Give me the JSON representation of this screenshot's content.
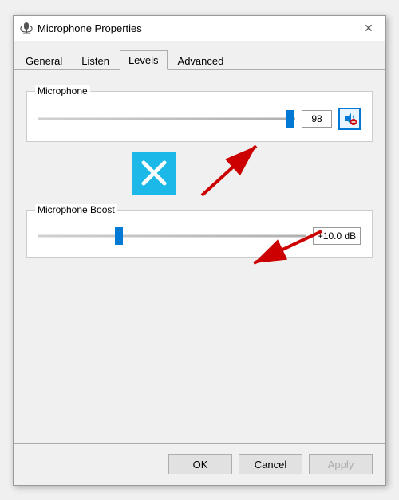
{
  "window": {
    "title": "Microphone Properties",
    "icon": "🎤"
  },
  "tabs": [
    {
      "label": "General",
      "active": false
    },
    {
      "label": "Listen",
      "active": false
    },
    {
      "label": "Levels",
      "active": true
    },
    {
      "label": "Advanced",
      "active": false
    }
  ],
  "microphone_section": {
    "label": "Microphone",
    "value": "98",
    "slider_pct": 98
  },
  "boost_section": {
    "label": "Microphone Boost",
    "value": "+10.0 dB",
    "slider_pct": 30
  },
  "footer": {
    "ok_label": "OK",
    "cancel_label": "Cancel",
    "apply_label": "Apply"
  }
}
